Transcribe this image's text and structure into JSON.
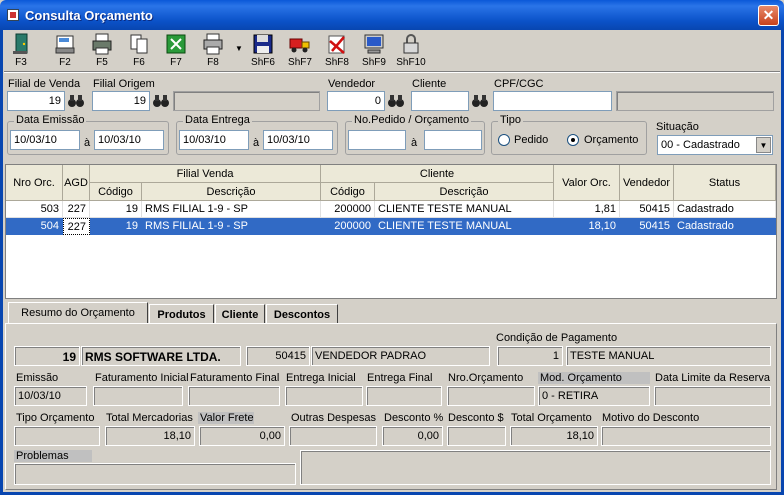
{
  "window": {
    "title": "Consulta Orçamento",
    "close": "✕"
  },
  "toolbar": [
    {
      "label": "F3",
      "icon": "exit-door-icon"
    },
    {
      "label": "F2",
      "icon": "print-preview-icon"
    },
    {
      "label": "F5",
      "icon": "printer-icon"
    },
    {
      "label": "F6",
      "icon": "copy-document-icon"
    },
    {
      "label": "F7",
      "icon": "spreadsheet-icon"
    },
    {
      "label": "F8",
      "icon": "print-options-icon"
    },
    {
      "label": "ShF6",
      "icon": "save-disk-icon"
    },
    {
      "label": "ShF7",
      "icon": "delivery-truck-icon"
    },
    {
      "label": "ShF8",
      "icon": "cancel-edit-icon"
    },
    {
      "label": "ShF9",
      "icon": "computer-icon"
    },
    {
      "label": "ShF10",
      "icon": "padlock-icon"
    }
  ],
  "filters": {
    "filial_venda": {
      "label": "Filial de Venda",
      "value": "19"
    },
    "filial_origem": {
      "label": "Filial Origem",
      "value": "19",
      "name": ""
    },
    "vendedor": {
      "label": "Vendedor",
      "value": "0"
    },
    "cliente": {
      "label": "Cliente",
      "value": ""
    },
    "cpf": {
      "label": "CPF/CGC",
      "value": "",
      "name": ""
    },
    "data_emissao": {
      "label": "Data Emissão",
      "from": "10/03/10",
      "to": "10/03/10",
      "sep": "à"
    },
    "data_entrega": {
      "label": "Data Entrega",
      "from": "10/03/10",
      "to": "10/03/10",
      "sep": "à"
    },
    "nro_pedido": {
      "label": "No.Pedido / Orçamento",
      "from": "",
      "to": "",
      "sep": "à"
    },
    "tipo": {
      "label": "Tipo",
      "opt1": "Pedido",
      "opt2": "Orçamento",
      "selected": "Orçamento"
    },
    "situacao": {
      "label": "Situação",
      "value": "00 - Cadastrado"
    }
  },
  "grid": {
    "headers": {
      "nro": "Nro Orc.",
      "agd": "AGD",
      "filial_group": "Filial Venda",
      "codigo": "Código",
      "descricao": "Descrição",
      "cliente_group": "Cliente",
      "codigo2": "Código",
      "descricao2": "Descrição",
      "valor": "Valor Orc.",
      "vendedor": "Vendedor",
      "status": "Status"
    },
    "rows": [
      {
        "nro": "503",
        "agd": "227",
        "fil_cod": "19",
        "fil_desc": "RMS FILIAL 1-9 - SP",
        "cli_cod": "200000",
        "cli_desc": "CLIENTE TESTE MANUAL",
        "valor": "1,81",
        "vendedor": "50415",
        "status": "Cadastrado"
      },
      {
        "nro": "504",
        "agd": "227",
        "fil_cod": "19",
        "fil_desc": "RMS FILIAL 1-9 - SP",
        "cli_cod": "200000",
        "cli_desc": "CLIENTE TESTE MANUAL",
        "valor": "18,10",
        "vendedor": "50415",
        "status": "Cadastrado"
      }
    ]
  },
  "tabs": [
    "Resumo do Orçamento",
    "Produtos",
    "Cliente",
    "Descontos"
  ],
  "resumo": {
    "condicao_label": "Condição de Pagamento",
    "filial_cod": "19",
    "filial_nome": "RMS SOFTWARE LTDA.",
    "vend_cod": "50415",
    "vend_nome": "VENDEDOR PADRAO",
    "cond_cod": "1",
    "cond_nome": "TESTE MANUAL",
    "labels1": {
      "emissao": "Emissão",
      "fat_ini": "Faturamento Inicial",
      "fat_fim": "Faturamento Final",
      "ent_ini": "Entrega Inicial",
      "ent_fim": "Entrega Final",
      "nro_orc": "Nro.Orçamento",
      "mod_orc": "Mod. Orçamento",
      "data_lim": "Data Limite da Reserva"
    },
    "emissao": "10/03/10",
    "mod_orc": "0 - RETIRA",
    "labels2": {
      "tipo": "Tipo Orçamento",
      "total_merc": "Total Mercadorias",
      "valor_frete": "Valor Frete",
      "outras": "Outras Despesas",
      "desc_pct": "Desconto %",
      "desc_val": "Desconto $",
      "total_orc": "Total Orçamento",
      "motivo": "Motivo do Desconto"
    },
    "total_merc": "18,10",
    "valor_frete": "0,00",
    "desc_pct": "0,00",
    "total_orc": "18,10",
    "problemas": "Problemas"
  }
}
